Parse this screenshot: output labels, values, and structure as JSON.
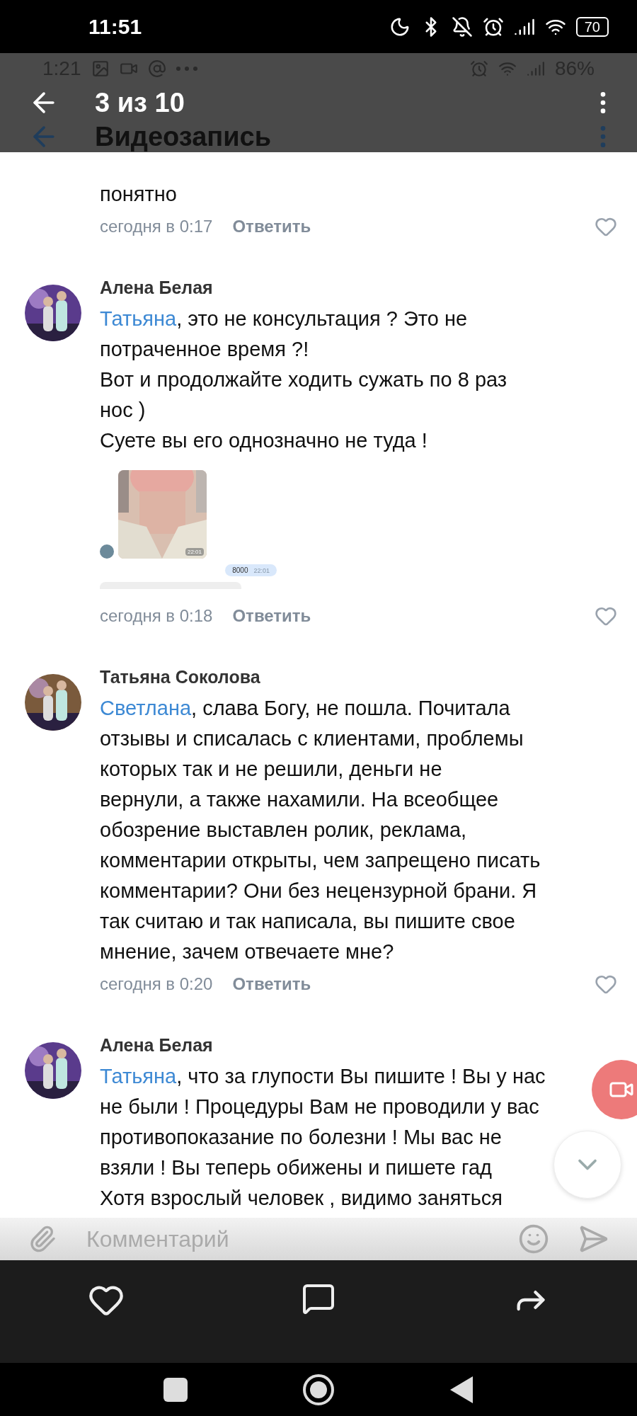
{
  "status_bar": {
    "time": "11:51",
    "battery": "70"
  },
  "inner_status_bar": {
    "time": "1:21",
    "battery": "86%"
  },
  "viewer": {
    "counter": "3 из 10"
  },
  "page": {
    "title": "Видеозапись"
  },
  "comments": [
    {
      "kind": "tail",
      "lines": [
        "понятно"
      ],
      "time": "сегодня в 0:17",
      "reply": "Ответить",
      "liked": false
    },
    {
      "kind": "full",
      "author": "Алена Белая",
      "mention": "Татьяна",
      "lines": [
        ", это не консультация ? Это не",
        "потраченное время ?!",
        "Вот и продолжайте ходить сужать по 8 раз",
        "нос )",
        "Суете вы его однозначно не туда !"
      ],
      "attachment": {
        "photo_time": "22:01",
        "bubble": "8000",
        "bubble_time": "22:01"
      },
      "time": "сегодня в 0:18",
      "reply": "Ответить",
      "liked": false
    },
    {
      "kind": "full",
      "author": "Татьяна Соколова",
      "mention": "Светлана",
      "lines": [
        ", слава Богу, не пошла. Почитала",
        "отзывы и списалась с клиентами, проблемы",
        "которых так и не решили, деньги не",
        "вернули, а также нахамили. На всеобщее",
        "обозрение выставлен ролик, реклама,",
        "комментарии открыты, чем запрещено писать",
        "комментарии? Они без нецензурной брани. Я",
        "так считаю и так написала, вы пишите свое",
        "мнение, зачем отвечаете мне?"
      ],
      "time": "сегодня в 0:20",
      "reply": "Ответить",
      "liked": false
    },
    {
      "kind": "full",
      "author": "Алена Белая",
      "mention": "Татьяна",
      "lines": [
        ", что за глупости Вы пишите ! Вы у нас",
        "не были ! Процедуры Вам не проводили у вас",
        "противопоказание по болезни ! Мы вас не",
        "взяли ! Вы теперь обижены и пишете гад",
        "Хотя взрослый человек , видимо заняться"
      ]
    }
  ],
  "composer": {
    "placeholder": "Комментарий"
  }
}
